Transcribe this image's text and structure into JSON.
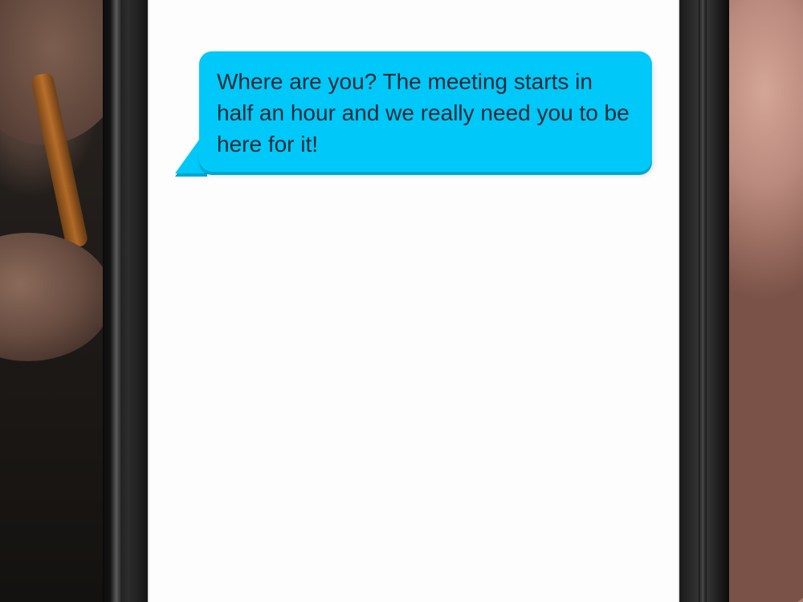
{
  "message": {
    "text": "Where are you? The meeting starts in half an hour and we really need you to be here for it!",
    "direction": "incoming"
  },
  "colors": {
    "bubble": "#00c8f8",
    "bubble_shadow": "#00a7cf",
    "text": "#1f2a36",
    "screen": "#fdfdfd"
  }
}
